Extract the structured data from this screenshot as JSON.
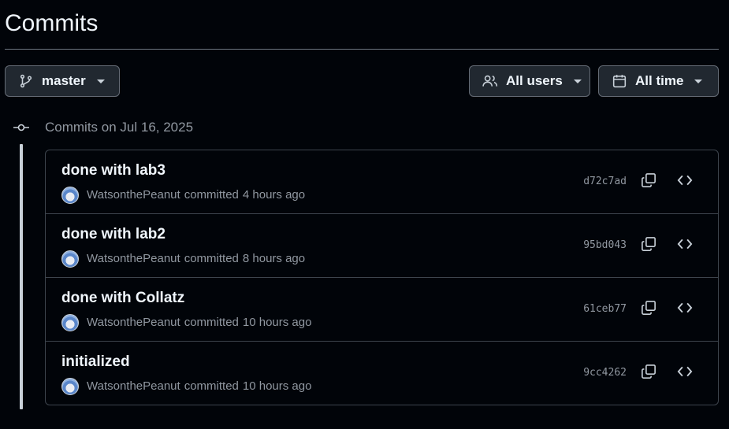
{
  "page": {
    "title": "Commits"
  },
  "filters": {
    "branch": {
      "label": "master",
      "icon": "git-branch-icon"
    },
    "users": {
      "label": "All users",
      "icon": "people-icon"
    },
    "time": {
      "label": "All time",
      "icon": "calendar-icon"
    }
  },
  "group": {
    "heading": "Commits on Jul 16, 2025",
    "icon": "git-commit-icon"
  },
  "commits": [
    {
      "title": "done with lab3",
      "author": "WatsonthePeanut",
      "action": "committed",
      "time": "4 hours ago",
      "sha": "d72c7ad"
    },
    {
      "title": "done with lab2",
      "author": "WatsonthePeanut",
      "action": "committed",
      "time": "8 hours ago",
      "sha": "95bd043"
    },
    {
      "title": "done with Collatz",
      "author": "WatsonthePeanut",
      "action": "committed",
      "time": "10 hours ago",
      "sha": "61ceb77"
    },
    {
      "title": "initialized",
      "author": "WatsonthePeanut",
      "action": "committed",
      "time": "10 hours ago",
      "sha": "9cc4262"
    }
  ],
  "row_actions": {
    "copy_icon": "copy-icon",
    "browse_icon": "code-icon"
  },
  "colors": {
    "background": "#010409",
    "border": "#3d444d",
    "text": "#f0f6fc",
    "muted": "#9198a1"
  }
}
